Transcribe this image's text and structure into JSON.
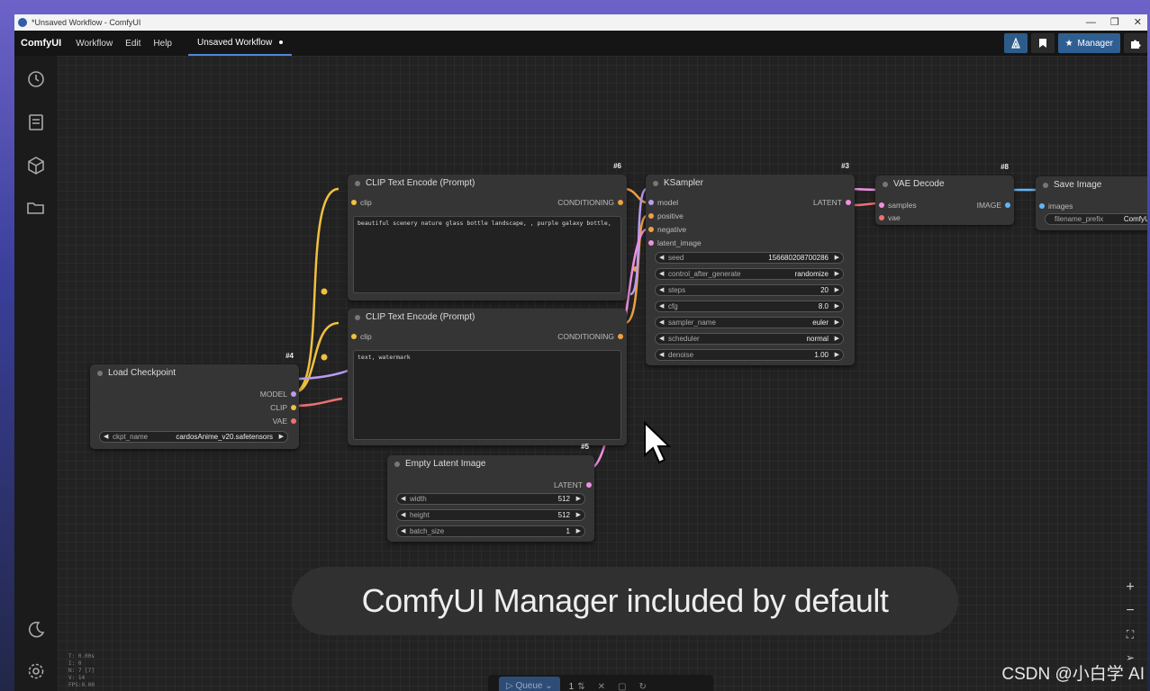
{
  "titlebar": {
    "title": "*Unsaved Workflow - ComfyUI",
    "minimize": "—",
    "restore": "❐",
    "close": "✕"
  },
  "menubar": {
    "brand": "ComfyUI",
    "items": [
      "Workflow",
      "Edit",
      "Help"
    ],
    "tab": "Unsaved Workflow",
    "manager_label": "Manager"
  },
  "nodes": {
    "clip1": {
      "id": "#6",
      "title": "CLIP Text Encode (Prompt)",
      "input": "clip",
      "output": "CONDITIONING",
      "text": "beautiful scenery nature glass bottle landscape, , purple galaxy bottle,"
    },
    "clip2": {
      "id": "",
      "title": "CLIP Text Encode (Prompt)",
      "input": "clip",
      "output": "CONDITIONING",
      "text": "text, watermark"
    },
    "ksampler": {
      "id": "#3",
      "title": "KSampler",
      "inputs": [
        "model",
        "positive",
        "negative",
        "latent_image"
      ],
      "output": "LATENT",
      "widgets": [
        {
          "label": "seed",
          "value": "156680208700286"
        },
        {
          "label": "control_after_generate",
          "value": "randomize"
        },
        {
          "label": "steps",
          "value": "20"
        },
        {
          "label": "cfg",
          "value": "8.0"
        },
        {
          "label": "sampler_name",
          "value": "euler"
        },
        {
          "label": "scheduler",
          "value": "normal"
        },
        {
          "label": "denoise",
          "value": "1.00"
        }
      ]
    },
    "vae": {
      "id": "#8",
      "title": "VAE Decode",
      "inputs": [
        "samples",
        "vae"
      ],
      "output": "IMAGE"
    },
    "save": {
      "id": "",
      "title": "Save Image",
      "input": "images",
      "widget_label": "filename_prefix",
      "widget_value": "ComfyUI"
    },
    "checkpoint": {
      "id": "#4",
      "title": "Load Checkpoint",
      "outputs": [
        "MODEL",
        "CLIP",
        "VAE"
      ],
      "widget_label": "ckpt_name",
      "widget_value": "cardosAnime_v20.safetensors"
    },
    "latent": {
      "id": "#5",
      "title": "Empty Latent Image",
      "output": "LATENT",
      "widgets": [
        {
          "label": "width",
          "value": "512"
        },
        {
          "label": "height",
          "value": "512"
        },
        {
          "label": "batch_size",
          "value": "1"
        }
      ]
    }
  },
  "caption": "ComfyUI Manager included by default",
  "stats": [
    "T: 0.00s",
    "I: 0",
    "N: 7 [7]",
    "V: 14",
    "FPS:0.00"
  ],
  "queue": {
    "label": "Queue",
    "count": "1"
  },
  "watermark": "CSDN @小白学 AI",
  "colors": {
    "clip": "#f0c040",
    "model": "#b89cf0",
    "vae": "#f07070",
    "latent": "#f090e0",
    "image": "#64b5f6",
    "conditioning": "#f0a040"
  }
}
